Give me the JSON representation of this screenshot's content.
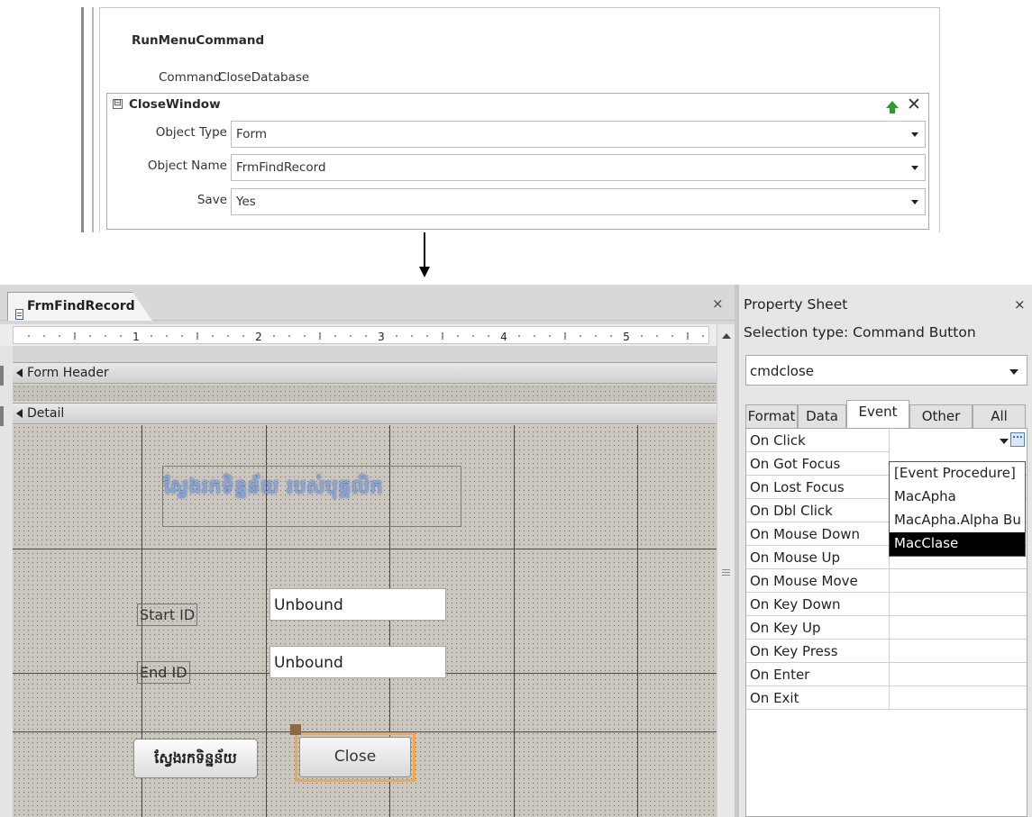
{
  "macro": {
    "action_name": "RunMenuCommand",
    "command_label": "Command",
    "command_value": "CloseDatabase",
    "closewindow": {
      "title": "CloseWindow",
      "collapse_glyph": "⊟",
      "delete_glyph": "✕",
      "args": [
        {
          "label": "Object Type",
          "value": "Form"
        },
        {
          "label": "Object Name",
          "value": "FrmFindRecord"
        },
        {
          "label": "Save",
          "value": "Yes"
        }
      ]
    }
  },
  "designer": {
    "tab_title": "FrmFindRecord",
    "tab_close": "×",
    "ruler_numbers": [
      "1",
      "2",
      "3",
      "4",
      "5"
    ],
    "form_header_label": "Form Header",
    "detail_label": "Detail",
    "form_title_text": "ស្វែងរកទិន្នន័យ របស់បុគ្គលិក",
    "start_label": "Start ID",
    "end_label": "End ID",
    "start_value": "Unbound",
    "end_value": "Unbound",
    "search_button_label": "ស្វែងរកទិន្នន័យ",
    "close_button_label": "Close"
  },
  "property_sheet": {
    "title": "Property Sheet",
    "close_glyph": "×",
    "selection_type": "Selection type:  Command Button",
    "selected_control": "cmdclose",
    "tabs": [
      "Format",
      "Data",
      "Event",
      "Other",
      "All"
    ],
    "active_tab": "Event",
    "properties": [
      "On Click",
      "On Got Focus",
      "On Lost Focus",
      "On Dbl Click",
      "On Mouse Down",
      "On Mouse Up",
      "On Mouse Move",
      "On Key Down",
      "On Key Up",
      "On Key Press",
      "On Enter",
      "On Exit"
    ],
    "builder_glyph": "...",
    "dropdown_options": [
      "[Event Procedure]",
      "MacApha",
      "MacApha.Alpha Bu",
      "MacClase"
    ],
    "dropdown_selected": "MacClase"
  },
  "colors": {
    "selection_orange": "#f2a84a",
    "title_blue": "#8aa6d8",
    "move_up_green": "#2a9d2a"
  }
}
